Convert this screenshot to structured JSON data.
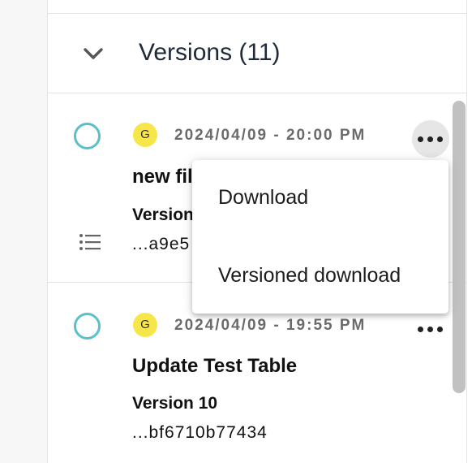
{
  "versions_header": {
    "title": "Versions (11)"
  },
  "versions": [
    {
      "avatar_initial": "G",
      "timestamp": "2024/04/09 - 20:00 PM",
      "title": "new file",
      "version_label": "Version 11",
      "hash": "...a9e5"
    },
    {
      "avatar_initial": "G",
      "timestamp": "2024/04/09 - 19:55 PM",
      "title": "Update Test Table",
      "version_label": "Version 10",
      "hash": "...bf6710b77434"
    }
  ],
  "context_menu": {
    "items": [
      {
        "label": "Download"
      },
      {
        "label": "Versioned download"
      }
    ]
  },
  "icons": {
    "collapse": "chevron-down-icon",
    "more": "more-horizontal-icon",
    "details": "list-icon"
  },
  "colors": {
    "select_ring": "#5bc0c9",
    "avatar_bg": "#f7e64a",
    "scroll_thumb": "#c1c1c1"
  }
}
